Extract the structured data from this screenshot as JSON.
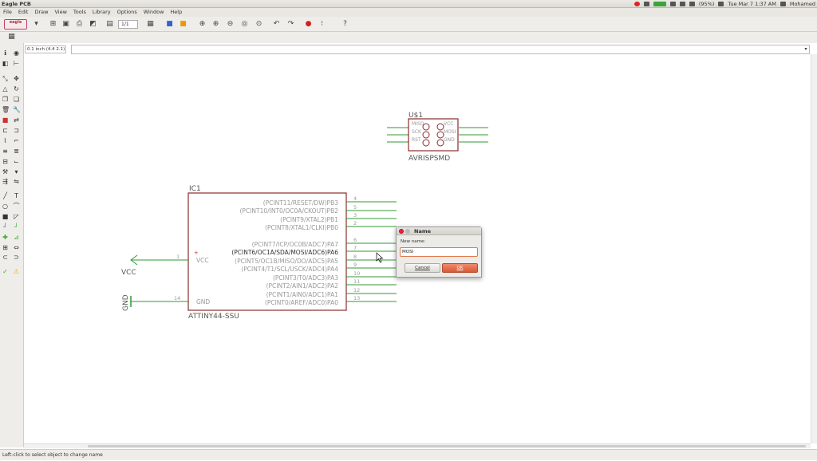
{
  "app_title": "Eagle PCB",
  "tray": {
    "datetime": "Tue Mar 7 1:37 AM",
    "user": "Mohamed",
    "battery": "(95%)"
  },
  "menu": [
    "File",
    "Edit",
    "Draw",
    "View",
    "Tools",
    "Library",
    "Options",
    "Window",
    "Help"
  ],
  "toolbar": {
    "page": "1/1",
    "logo": "eagle"
  },
  "coord": "0.1 inch (4.4 2.1)",
  "status": "Left-click to select object to change name",
  "dialog": {
    "title": "Name",
    "label": "New name:",
    "value": "MOSI",
    "cancel": "Cancel",
    "ok": "OK"
  },
  "schematic": {
    "colors": {
      "body": "#8b2b2b",
      "wire": "#2f9a2f",
      "pin_text": "#999999",
      "label": "#555555"
    },
    "u1": {
      "name": "U$1",
      "value": "AVRISPSMD",
      "pins": [
        "MISO",
        "SCK",
        "RST",
        "VCC",
        "MOSI",
        "GND"
      ]
    },
    "ic1": {
      "name": "IC1",
      "value": "ATTINY44-SSU",
      "left_pins": [
        {
          "num": "1",
          "label": "VCC"
        },
        {
          "num": "14",
          "label": "GND"
        }
      ],
      "right_pins": [
        {
          "num": "4",
          "label": "(PCINT11/RESET/DW)PB3"
        },
        {
          "num": "5",
          "label": "(PCINT10/INT0/OC0A/CKOUT)PB2"
        },
        {
          "num": "3",
          "label": "(PCINT9/XTAL2)PB1"
        },
        {
          "num": "2",
          "label": "(PCINT8/XTAL1/CLKI)PB0"
        },
        {
          "num": "6",
          "label": "(PCINT7/ICP/OC0B/ADC7)PA7"
        },
        {
          "num": "7",
          "label": "(PCINT6/OC1A/SDA/MOSI/ADC6)PA6"
        },
        {
          "num": "8",
          "label": "(PCINT5/OC1B/MISO/DO/ADC5)PA5"
        },
        {
          "num": "9",
          "label": "(PCINT4/T1/SCL/USCK/ADC4)PA4"
        },
        {
          "num": "10",
          "label": "(PCINT3/T0/ADC3)PA3"
        },
        {
          "num": "11",
          "label": "(PCINT2/AIN1/ADC2)PA2"
        },
        {
          "num": "12",
          "label": "(PCINT1/AIN0/ADC1)PA1"
        },
        {
          "num": "13",
          "label": "(PCINT0/AREF/ADC0)PA0"
        }
      ]
    },
    "supply": {
      "vcc": "VCC",
      "gnd": "GND"
    }
  }
}
